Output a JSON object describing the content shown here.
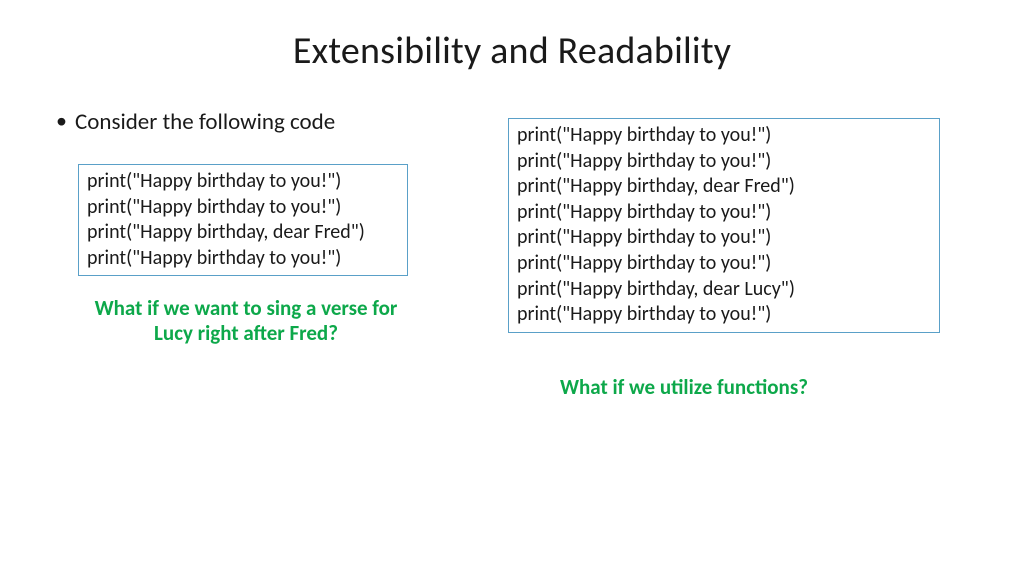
{
  "title": "Extensibility and Readability",
  "bullet": "Consider the following code",
  "code_left": [
    "print(\"Happy birthday to you!\")",
    "print(\"Happy birthday to you!\")",
    "print(\"Happy birthday, dear Fred\")",
    "print(\"Happy birthday to you!\")"
  ],
  "code_right": [
    "print(\"Happy birthday to you!\")",
    "print(\"Happy birthday to you!\")",
    "print(\"Happy birthday, dear Fred\")",
    "print(\"Happy birthday to you!\")",
    "print(\"Happy birthday to you!\")",
    "print(\"Happy birthday to you!\")",
    "print(\"Happy birthday, dear Lucy\")",
    "print(\"Happy birthday to you!\")"
  ],
  "prompt_left_line1": "What if we want to sing a verse for",
  "prompt_left_line2": "Lucy right after Fred?",
  "prompt_right": "What if we utilize functions?"
}
